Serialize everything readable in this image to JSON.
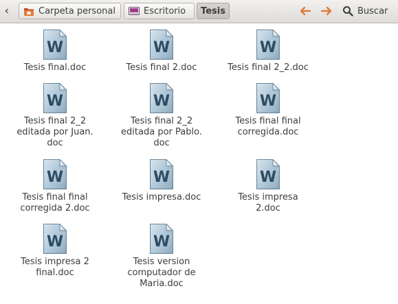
{
  "toolbar": {
    "breadcrumbs": [
      {
        "label": "Carpeta personal",
        "icon": "home-folder-icon"
      },
      {
        "label": "Escritorio",
        "icon": "desktop-icon"
      },
      {
        "label": "Tesis",
        "active": true
      }
    ],
    "back_icon": "arrow-left-icon",
    "forward_icon": "arrow-right-icon",
    "search_label": "Buscar",
    "accent_color": "#e07b39"
  },
  "files": [
    {
      "name": "Tesis final.doc",
      "icon": "word-document-icon"
    },
    {
      "name": "Tesis final 2.doc",
      "icon": "word-document-icon"
    },
    {
      "name": "Tesis final 2_2.doc",
      "icon": "word-document-icon"
    },
    {
      "name": "Tesis final 2_2\neditada por Juan.\ndoc",
      "icon": "word-document-icon"
    },
    {
      "name": "Tesis final 2_2\neditada por Pablo.\ndoc",
      "icon": "word-document-icon"
    },
    {
      "name": "Tesis final final\ncorregida.doc",
      "icon": "word-document-icon"
    },
    {
      "name": "Tesis final final\ncorregida 2.doc",
      "icon": "word-document-icon"
    },
    {
      "name": "Tesis impresa.doc",
      "icon": "word-document-icon"
    },
    {
      "name": "Tesis impresa 2.doc",
      "icon": "word-document-icon"
    },
    {
      "name": "Tesis impresa 2\nfinal.doc",
      "icon": "word-document-icon"
    },
    {
      "name": "Tesis version\ncomputador de\nMaria.doc",
      "icon": "word-document-icon"
    }
  ]
}
